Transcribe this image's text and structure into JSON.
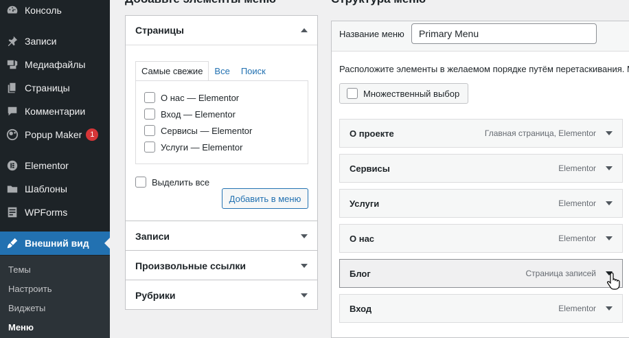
{
  "sidebar": {
    "items": [
      {
        "label": "Консоль",
        "icon": "dashboard-icon"
      },
      {
        "label": "Записи",
        "icon": "pin-icon"
      },
      {
        "label": "Медиафайлы",
        "icon": "media-icon"
      },
      {
        "label": "Страницы",
        "icon": "pages-icon"
      },
      {
        "label": "Комментарии",
        "icon": "comments-icon"
      },
      {
        "label": "Popup Maker",
        "icon": "popup-maker-icon",
        "badge": "1"
      },
      {
        "label": "Elementor",
        "icon": "elementor-icon"
      },
      {
        "label": "Шаблоны",
        "icon": "folder-icon"
      },
      {
        "label": "WPForms",
        "icon": "forms-icon"
      },
      {
        "label": "Внешний вид",
        "icon": "brush-icon"
      }
    ],
    "submenu": [
      "Темы",
      "Настроить",
      "Виджеты",
      "Меню"
    ]
  },
  "left_panel": {
    "heading": "Добавьте элементы меню",
    "pages_section": {
      "title": "Страницы",
      "tabs": [
        "Самые свежие",
        "Все",
        "Поиск"
      ],
      "items": [
        {
          "name": "О нас",
          "suffix": "— Elementor"
        },
        {
          "name": "Вход",
          "suffix": "— Elementor"
        },
        {
          "name": "Сервисы",
          "suffix": "— Elementor"
        },
        {
          "name": "Услуги",
          "suffix": "— Elementor"
        }
      ],
      "select_all": "Выделить все",
      "add_button": "Добавить в меню"
    },
    "sections": [
      "Записи",
      "Произвольные ссылки",
      "Рубрики"
    ]
  },
  "right_panel": {
    "heading": "Структура меню",
    "menu_name_label": "Название меню",
    "menu_name_value": "Primary Menu",
    "instructions": "Расположите элементы в желаемом порядке путём перетаскивания. М",
    "multi_select": "Множественный выбор",
    "menu_items": [
      {
        "title": "О проекте",
        "type": "Главная страница, Elementor"
      },
      {
        "title": "Сервисы",
        "type": "Elementor"
      },
      {
        "title": "Услуги",
        "type": "Elementor"
      },
      {
        "title": "О нас",
        "type": "Elementor"
      },
      {
        "title": "Блог",
        "type": "Страница записей"
      },
      {
        "title": "Вход",
        "type": "Elementor"
      }
    ]
  },
  "colors": {
    "admin_bar": "#1d2327",
    "accent": "#2271b1",
    "badge": "#d63638"
  }
}
